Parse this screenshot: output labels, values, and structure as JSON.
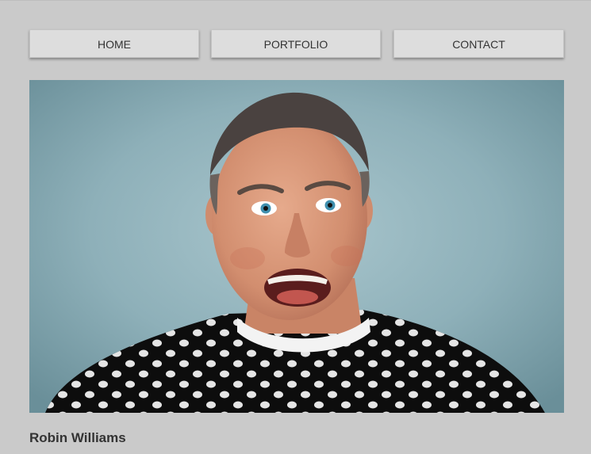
{
  "nav": {
    "home_label": "HOME",
    "portfolio_label": "PORTFOLIO",
    "contact_label": "CONTACT"
  },
  "photo": {
    "alt": "Robin Williams",
    "colors": {
      "background": "#8fb1ba",
      "skin": "#d99a7c",
      "hair": "#4a4340",
      "sweater": "#0c0c0c",
      "dots": "#f2f2f2"
    }
  },
  "caption": {
    "name": "Robin Williams"
  }
}
